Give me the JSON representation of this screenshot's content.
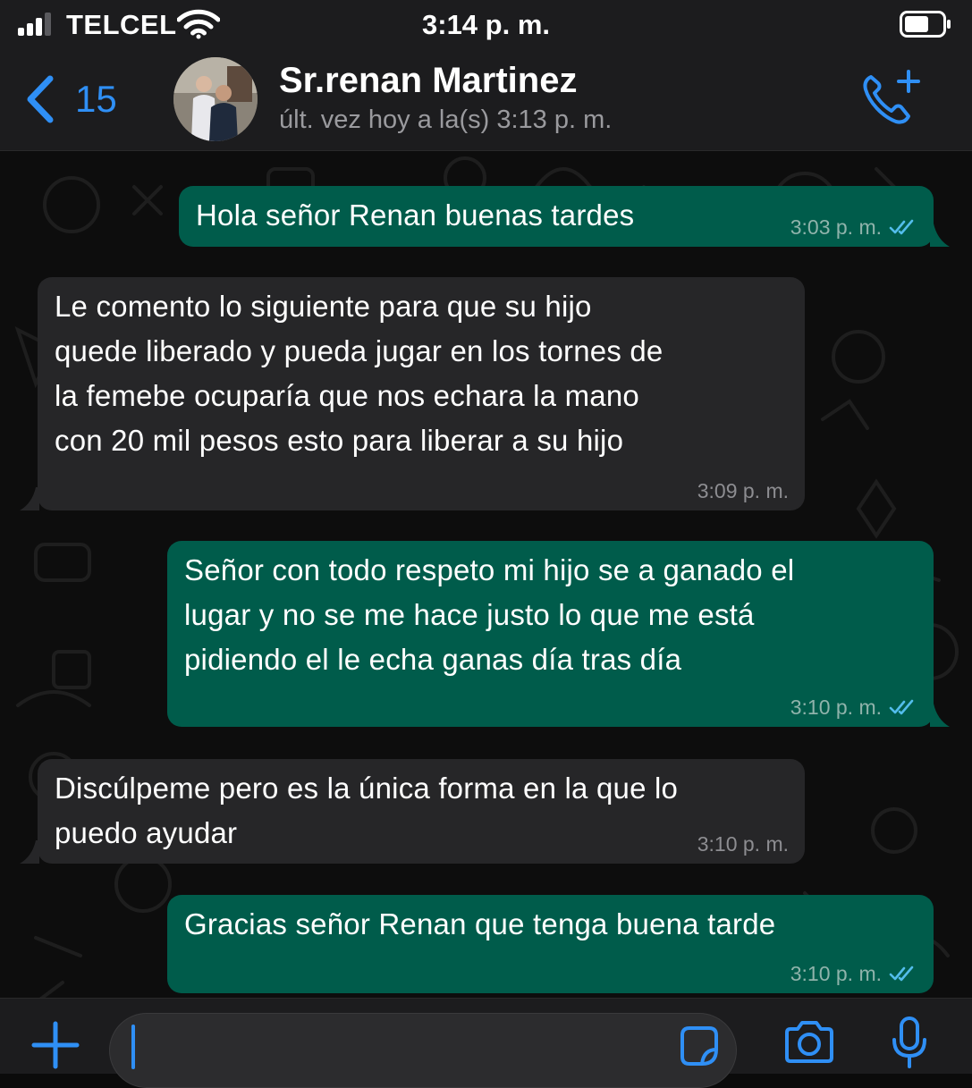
{
  "status_bar": {
    "carrier": "TELCEL",
    "time": "3:14 p. m."
  },
  "header": {
    "back_count": "15",
    "contact_name": "Sr.renan Martinez",
    "last_seen": "últ. vez hoy a la(s) 3:13 p. m."
  },
  "messages": [
    {
      "direction": "outgoing",
      "text": "Hola señor Renan buenas tardes",
      "time": "3:03 p. m.",
      "status": "read"
    },
    {
      "direction": "incoming",
      "text": "Le comento lo siguiente para que su hijo\nquede liberado y pueda jugar en los tornes de\nla femebe ocuparía que nos echara la mano\ncon 20 mil pesos esto para liberar a su hijo",
      "time": "3:09 p. m."
    },
    {
      "direction": "outgoing",
      "text": "Señor con todo respeto mi hijo se a ganado el\nlugar y no se me hace justo lo que me está\npidiendo el le echa ganas día tras día",
      "time": "3:10 p. m.",
      "status": "read"
    },
    {
      "direction": "incoming",
      "text": "Discúlpeme pero es la única forma en la que lo\npuedo ayudar",
      "time": "3:10 p. m."
    },
    {
      "direction": "outgoing",
      "text": "Gracias señor Renan que tenga buena tarde",
      "time": "3:10 p. m.",
      "status": "read"
    }
  ],
  "input": {
    "value": ""
  },
  "icons": {
    "signal": "signal-bars-icon",
    "wifi": "wifi-icon",
    "battery": "battery-icon",
    "back": "chevron-left-icon",
    "call": "add-call-icon",
    "attach": "plus-icon",
    "sticker": "sticker-icon",
    "camera": "camera-icon",
    "mic": "microphone-icon"
  },
  "colors": {
    "accent": "#2f8ff5",
    "outgoing_bubble": "#005c4b",
    "incoming_bubble": "#262628",
    "read_ticks": "#53bdeb"
  }
}
